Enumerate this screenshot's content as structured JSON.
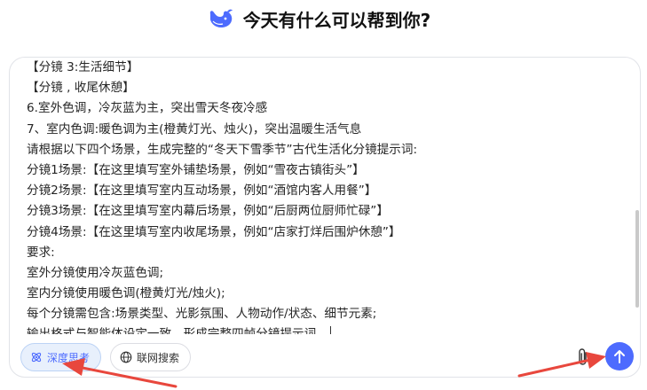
{
  "header": {
    "title": "今天有什么可以帮到你?",
    "logo_icon": "whale-logo-icon",
    "brand_color": "#4d6bfe"
  },
  "composer": {
    "lines": [
      "【分镜 3:生活细节】",
      "【分镜 , 收尾休憩】",
      "6.室外色调，冷灰蓝为主，突出雪天冬夜冷感",
      "7、室内色调:暖色调为主(橙黄灯光、烛火)，突出温暖生活气息",
      "请根据以下四个场景，生成完整的“冬天下雪季节”古代生活化分镜提示词:",
      "分镜1场景:【在这里填写室外铺垫场景，例如“雪夜古镇街头”】",
      "分镜2场景:【在这里填写室内互动场景，例如“酒馆内客人用餐”】",
      "分镜3场景:【在这里填写室内幕后场景，例如“后厨两位厨师忙碌”】",
      "分镜4场景:【在这里填写室内收尾场景，例如“店家打烊后围炉休憩”】",
      "要求:",
      "室外分镜使用冷灰蓝色调;",
      "室内分镜使用暖色调(橙黄灯光/烛火);",
      "每个分镜需包含:场景类型、光影氛围、人物动作/状态、细节元素;",
      "输出格式与智能体设定一致，形成完整四帧分镜提示词。"
    ]
  },
  "toolbar": {
    "deep_think_label": "深度思考",
    "deep_think_icon": "atom-icon",
    "web_search_label": "联网搜索",
    "web_search_icon": "globe-icon",
    "attach_icon": "paperclip-icon",
    "send_icon": "arrow-up-icon"
  },
  "colors": {
    "accent": "#4d6bfe",
    "annotation_arrow": "#e8473d"
  }
}
